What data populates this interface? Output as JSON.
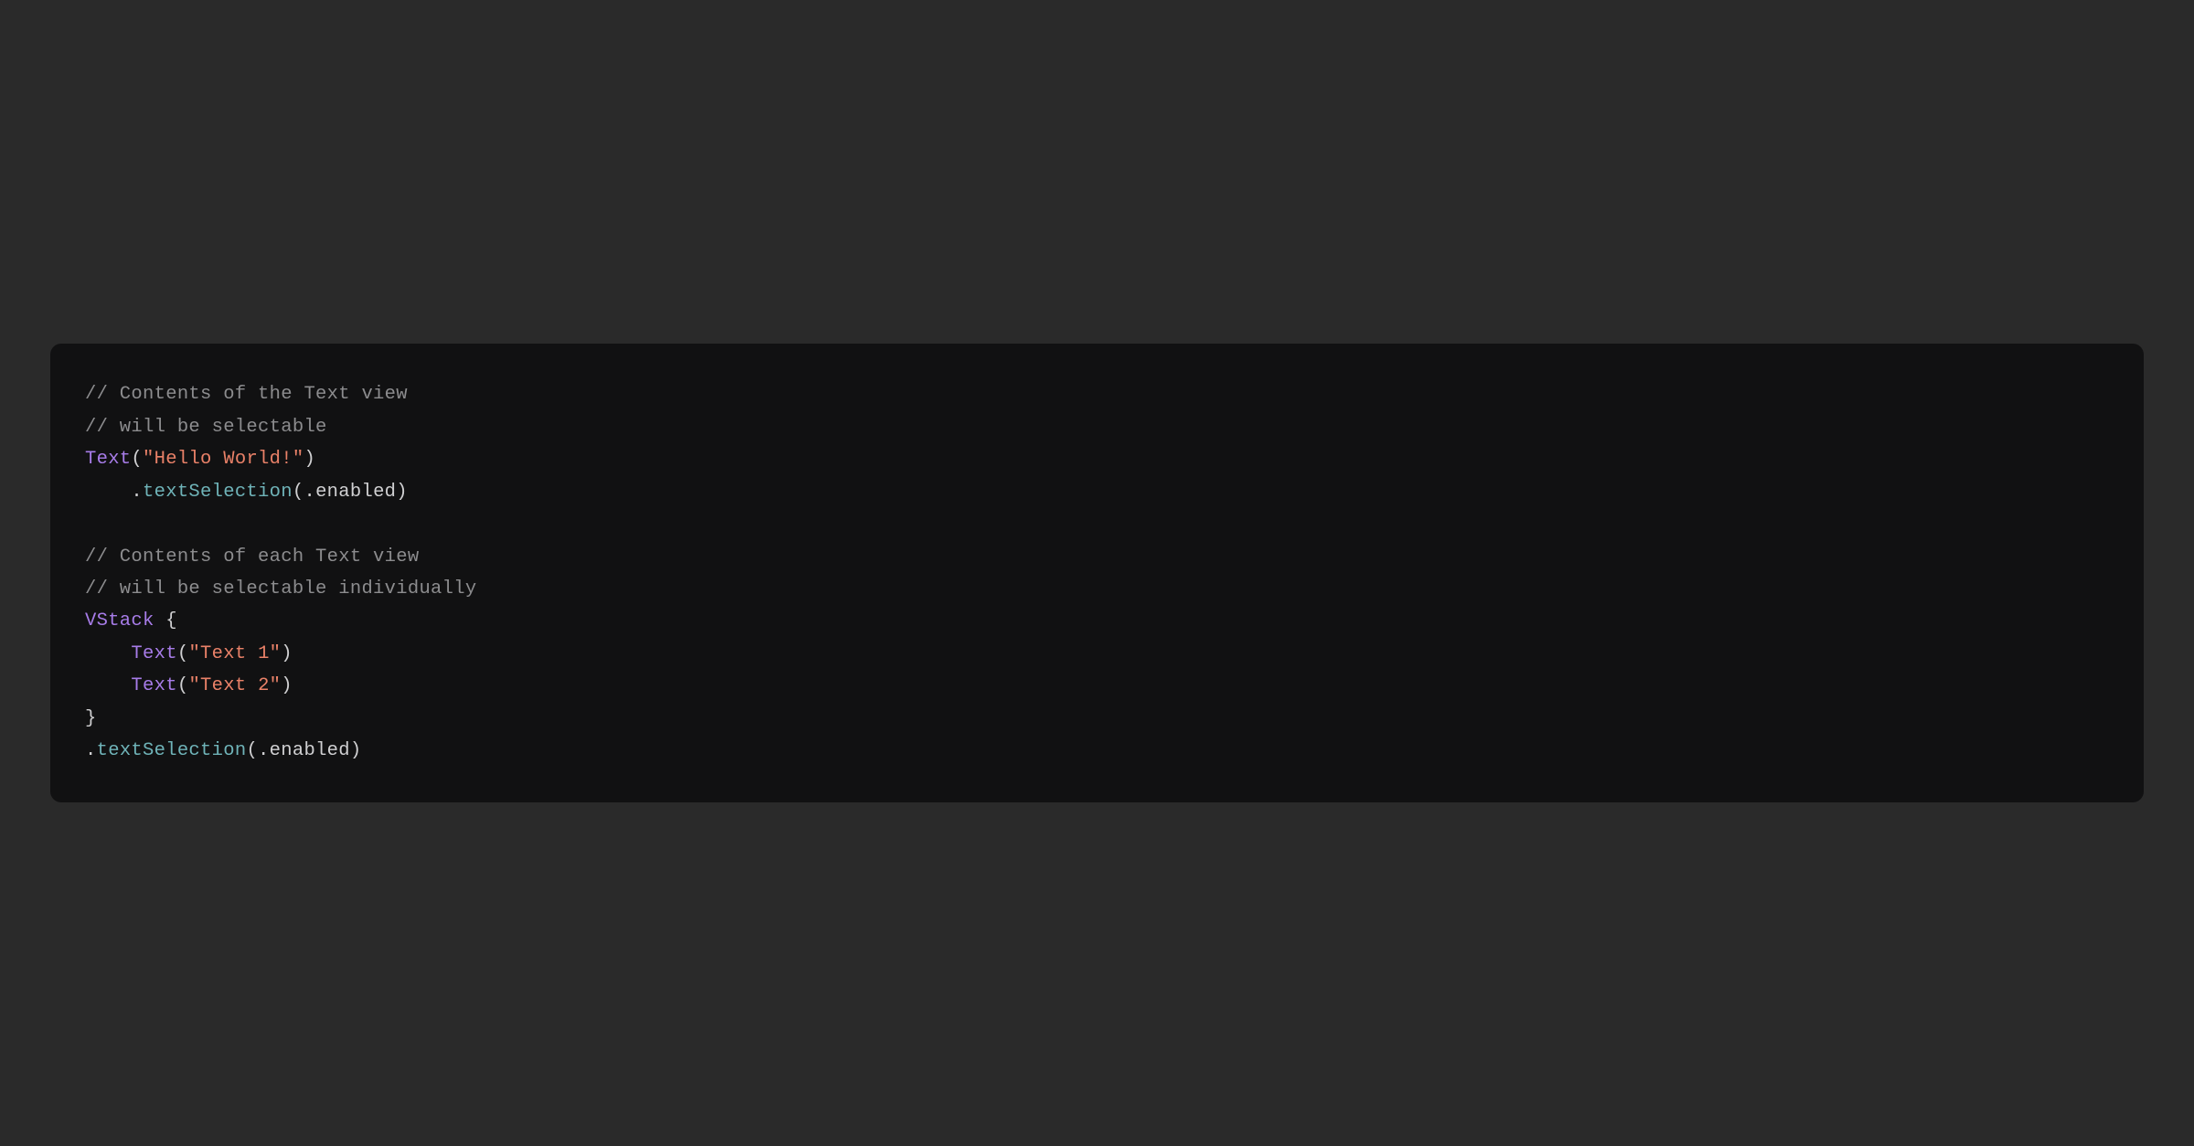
{
  "colors": {
    "background": "#2a2a2a",
    "code_bg": "#111112",
    "comment": "#8c8c8e",
    "type": "#a77ce8",
    "punct": "#d0d0d2",
    "string": "#e98168",
    "method": "#6fb3b8"
  },
  "code": {
    "lines": [
      {
        "tokens": [
          {
            "cls": "comment",
            "text": "// Contents of the Text view"
          }
        ]
      },
      {
        "tokens": [
          {
            "cls": "comment",
            "text": "// will be selectable"
          }
        ]
      },
      {
        "tokens": [
          {
            "cls": "type",
            "text": "Text"
          },
          {
            "cls": "punct",
            "text": "("
          },
          {
            "cls": "string",
            "text": "\"Hello World!\""
          },
          {
            "cls": "punct",
            "text": ")"
          }
        ]
      },
      {
        "tokens": [
          {
            "cls": "punct",
            "text": "    ."
          },
          {
            "cls": "method",
            "text": "textSelection"
          },
          {
            "cls": "punct",
            "text": "(."
          },
          {
            "cls": "default",
            "text": "enabled"
          },
          {
            "cls": "punct",
            "text": ")"
          }
        ]
      },
      {
        "tokens": [
          {
            "cls": "default",
            "text": ""
          }
        ]
      },
      {
        "tokens": [
          {
            "cls": "comment",
            "text": "// Contents of each Text view"
          }
        ]
      },
      {
        "tokens": [
          {
            "cls": "comment",
            "text": "// will be selectable individually"
          }
        ]
      },
      {
        "tokens": [
          {
            "cls": "type",
            "text": "VStack"
          },
          {
            "cls": "punct",
            "text": " {"
          }
        ]
      },
      {
        "tokens": [
          {
            "cls": "punct",
            "text": "    "
          },
          {
            "cls": "type",
            "text": "Text"
          },
          {
            "cls": "punct",
            "text": "("
          },
          {
            "cls": "string",
            "text": "\"Text 1\""
          },
          {
            "cls": "punct",
            "text": ")"
          }
        ]
      },
      {
        "tokens": [
          {
            "cls": "punct",
            "text": "    "
          },
          {
            "cls": "type",
            "text": "Text"
          },
          {
            "cls": "punct",
            "text": "("
          },
          {
            "cls": "string",
            "text": "\"Text 2\""
          },
          {
            "cls": "punct",
            "text": ")"
          }
        ]
      },
      {
        "tokens": [
          {
            "cls": "punct",
            "text": "}"
          }
        ]
      },
      {
        "tokens": [
          {
            "cls": "punct",
            "text": "."
          },
          {
            "cls": "method",
            "text": "textSelection"
          },
          {
            "cls": "punct",
            "text": "(."
          },
          {
            "cls": "default",
            "text": "enabled"
          },
          {
            "cls": "punct",
            "text": ")"
          }
        ]
      }
    ]
  }
}
